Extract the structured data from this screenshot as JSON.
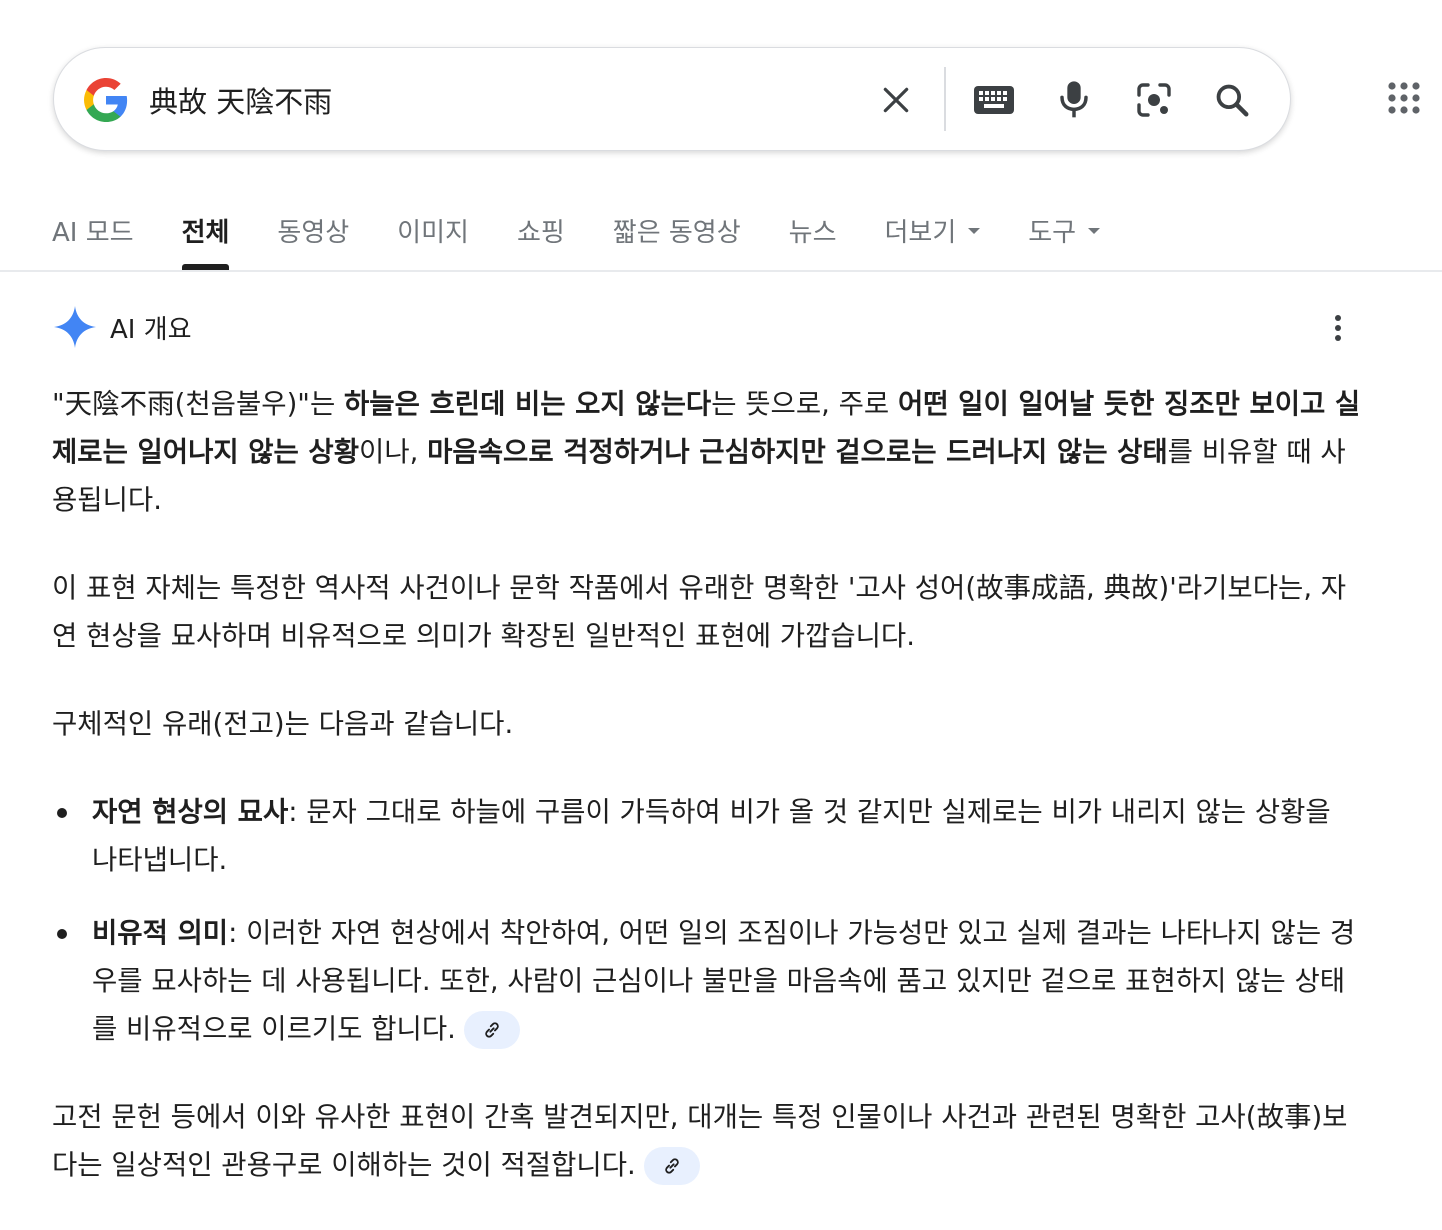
{
  "search": {
    "query": "典故 天陰不雨"
  },
  "tabs": [
    {
      "label": "AI 모드"
    },
    {
      "label": "전체"
    },
    {
      "label": "동영상"
    },
    {
      "label": "이미지"
    },
    {
      "label": "쇼핑"
    },
    {
      "label": "짧은 동영상"
    },
    {
      "label": "뉴스"
    },
    {
      "label": "더보기"
    },
    {
      "label": "도구"
    }
  ],
  "ai_overview": {
    "label": "AI 개요",
    "p1": {
      "t1": "\"天陰不雨(천음불우)\"는 ",
      "b1": "하늘은 흐린데 비는 오지 않는다",
      "t2": "는 뜻으로, 주로 ",
      "b2": "어떤 일이 일어날 듯한 징조만 보이고 실제로는 일어나지 않는 상황",
      "t3": "이나, ",
      "b3": "마음속으로 걱정하거나 근심하지만 겉으로는 드러나지 않는 상태",
      "t4": "를 비유할 때 사용됩니다."
    },
    "p2": "이 표현 자체는 특정한 역사적 사건이나 문학 작품에서 유래한 명확한 '고사 성어(故事成語, 典故)'라기보다는, 자연 현상을 묘사하며 비유적으로 의미가 확장된 일반적인 표현에 가깝습니다.",
    "p3": "구체적인 유래(전고)는 다음과 같습니다.",
    "bullets": [
      {
        "term": "자연 현상의 묘사",
        "text": ": 문자 그대로 하늘에 구름이 가득하여 비가 올 것 같지만 실제로는 비가 내리지 않는 상황을 나타냅니다."
      },
      {
        "term": "비유적 의미",
        "text": ": 이러한 자연 현상에서 착안하여, 어떤 일의 조짐이나 가능성만 있고 실제 결과는 나타나지 않는 경우를 묘사하는 데 사용됩니다. 또한, 사람이 근심이나 불만을 마음속에 품고 있지만 겉으로 표현하지 않는 상태를 비유적으로 이르기도 합니다."
      }
    ],
    "p4": "고전 문헌 등에서 이와 유사한 표현이 간혹 발견되지만, 대개는 특정 인물이나 사건과 관련된 명확한 고사(故事)보다는 일상적인 관용구로 이해하는 것이 적절합니다."
  },
  "colors": {
    "accent_blue": "#4285f4",
    "cite_bg": "#e8f0fe"
  }
}
